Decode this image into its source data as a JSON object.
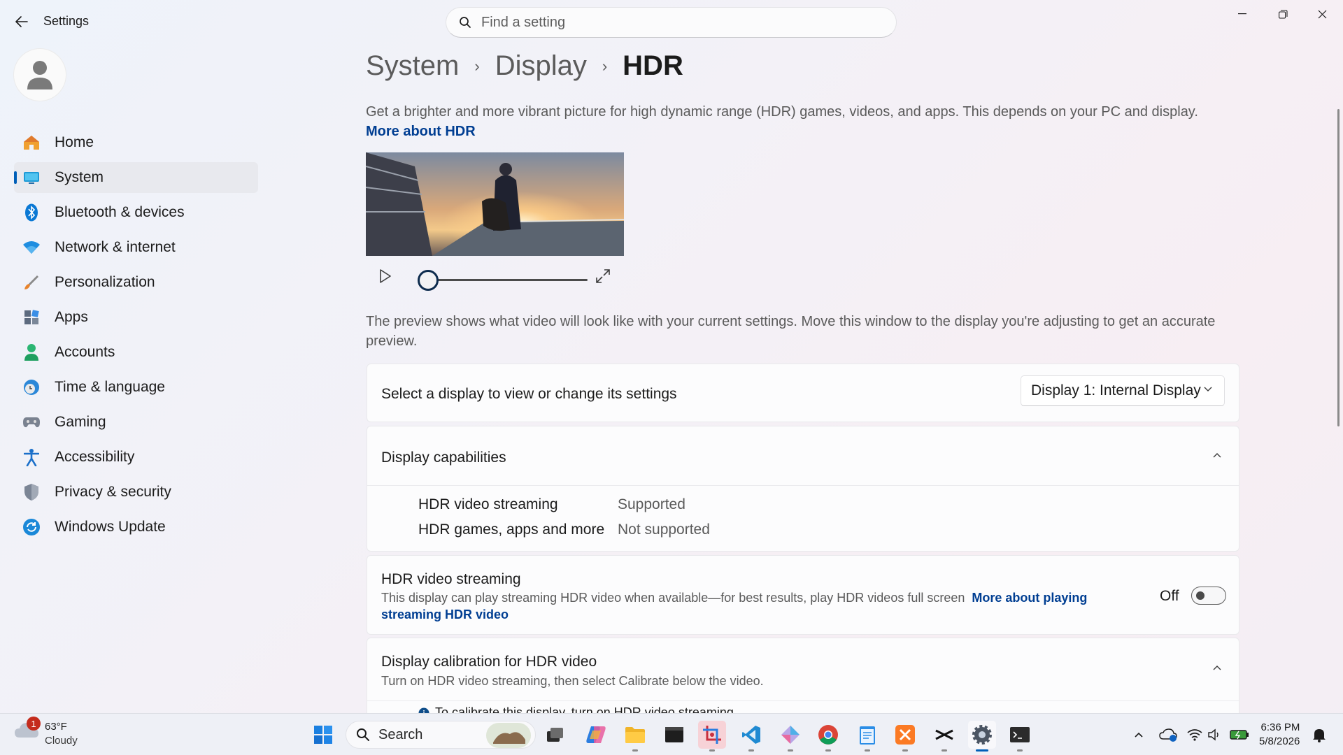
{
  "window": {
    "title": "Settings",
    "search_placeholder": "Find a setting"
  },
  "sidebar": {
    "items": [
      {
        "label": "Home",
        "icon": "home-icon"
      },
      {
        "label": "System",
        "icon": "system-icon",
        "active": true
      },
      {
        "label": "Bluetooth & devices",
        "icon": "bluetooth-icon"
      },
      {
        "label": "Network & internet",
        "icon": "wifi-icon"
      },
      {
        "label": "Personalization",
        "icon": "brush-icon"
      },
      {
        "label": "Apps",
        "icon": "apps-icon"
      },
      {
        "label": "Accounts",
        "icon": "person-icon"
      },
      {
        "label": "Time & language",
        "icon": "clock-globe-icon"
      },
      {
        "label": "Gaming",
        "icon": "controller-icon"
      },
      {
        "label": "Accessibility",
        "icon": "accessibility-icon"
      },
      {
        "label": "Privacy & security",
        "icon": "shield-icon"
      },
      {
        "label": "Windows Update",
        "icon": "update-icon"
      }
    ]
  },
  "breadcrumb": {
    "items": [
      "System",
      "Display",
      "HDR"
    ],
    "separator": "›"
  },
  "intro": {
    "text": "Get a brighter and more vibrant picture for high dynamic range (HDR) games, videos, and apps. This depends on your PC and display.",
    "link": "More about HDR"
  },
  "player": {
    "progress": 0
  },
  "preview_note": "The preview shows what video will look like with your current settings. Move this window to the display you're adjusting to get an accurate preview.",
  "display_select": {
    "label": "Select a display to view or change its settings",
    "value": "Display 1: Internal Display"
  },
  "capabilities": {
    "title": "Display capabilities",
    "rows": [
      {
        "name": "HDR video streaming",
        "value": "Supported"
      },
      {
        "name": "HDR games, apps and more",
        "value": "Not supported"
      }
    ]
  },
  "hdr_streaming": {
    "title": "HDR video streaming",
    "description": "This display can play streaming HDR video when available—for best results, play HDR videos full screen",
    "link": "More about playing streaming HDR video",
    "toggle_label": "Off",
    "enabled": false
  },
  "calibration": {
    "title": "Display calibration for HDR video",
    "description": "Turn on HDR video streaming, then select Calibrate below the video.",
    "info": "To calibrate this display, turn on HDR video streaming"
  },
  "taskbar": {
    "weather": {
      "temp": "63°F",
      "condition": "Cloudy",
      "badge": "1"
    },
    "search_label": "Search",
    "time": "6:36 PM",
    "date": "5/8/2026"
  },
  "colors": {
    "accent": "#005fb8",
    "link": "#003e92"
  }
}
